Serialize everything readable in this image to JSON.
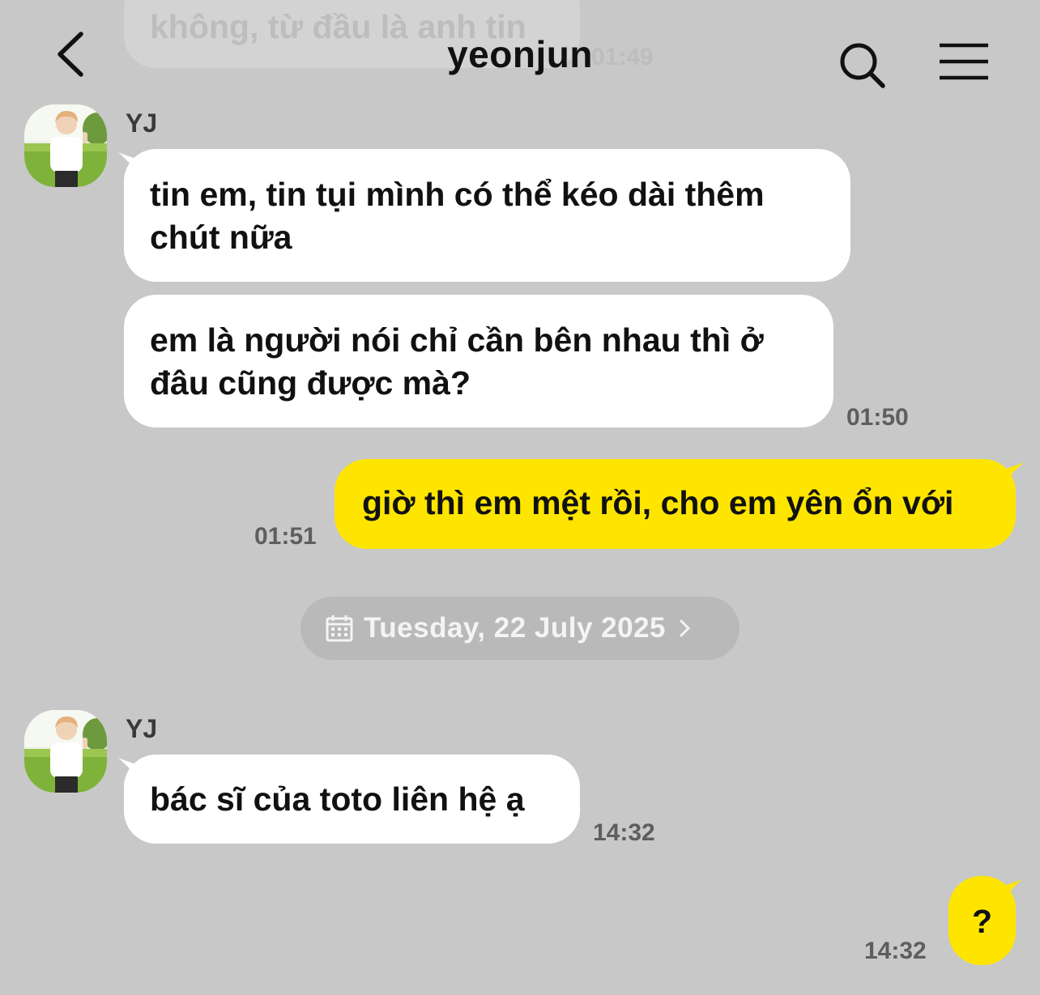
{
  "header": {
    "title": "yeonjun",
    "back_icon": "chevron-left-icon",
    "search_icon": "search-icon",
    "menu_icon": "hamburger-menu-icon"
  },
  "previous_message": {
    "text": "không, từ đầu là anh tin",
    "time": "01:49"
  },
  "messages": [
    {
      "sender": "YJ",
      "texts": [
        "tin em, tin tụi mình có thể kéo dài thêm chút nữa",
        "em là người nói chỉ cần bên nhau thì ở đâu cũng được mà?"
      ],
      "time": "01:50"
    },
    {
      "sender": "me",
      "text": "giờ thì em mệt rồi, cho em yên ổn với",
      "time": "01:51"
    },
    {
      "divider": "Tuesday, 22 July 2025"
    },
    {
      "sender": "YJ",
      "text": "bác sĩ của toto liên hệ ạ",
      "time": "14:32"
    },
    {
      "sender": "me",
      "text": "?",
      "time": "14:32"
    }
  ],
  "colors": {
    "background": "#c8c8c8",
    "my_bubble": "#fee500",
    "their_bubble": "#ffffff",
    "time_text": "#5e5e5e"
  }
}
